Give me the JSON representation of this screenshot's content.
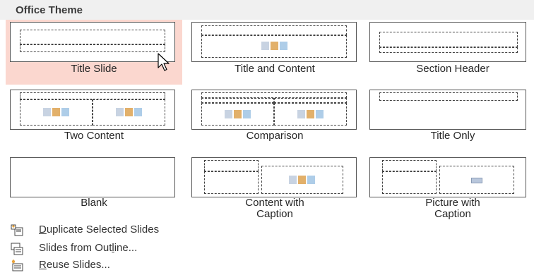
{
  "section_title": "Office Theme",
  "layouts": [
    {
      "label": "Title Slide",
      "selected": true
    },
    {
      "label": "Title and Content",
      "selected": false
    },
    {
      "label": "Section Header",
      "selected": false
    },
    {
      "label": "Two Content",
      "selected": false
    },
    {
      "label": "Comparison",
      "selected": false
    },
    {
      "label": "Title Only",
      "selected": false
    },
    {
      "label": "Blank",
      "selected": false
    },
    {
      "label": "Content with\nCaption",
      "selected": false
    },
    {
      "label": "Picture with\nCaption",
      "selected": false
    }
  ],
  "menu": [
    {
      "label": "Duplicate Selected Slides",
      "accelerator": "D",
      "icon": "duplicate-slides-icon"
    },
    {
      "label": "Slides from Outline...",
      "accelerator": "l",
      "icon": "slides-from-outline-icon"
    },
    {
      "label": "Reuse Slides...",
      "accelerator": "R",
      "icon": "reuse-slides-icon"
    }
  ],
  "colors": {
    "selected_tile": "#fbd7cf",
    "header_bg": "#f0f0f0"
  }
}
